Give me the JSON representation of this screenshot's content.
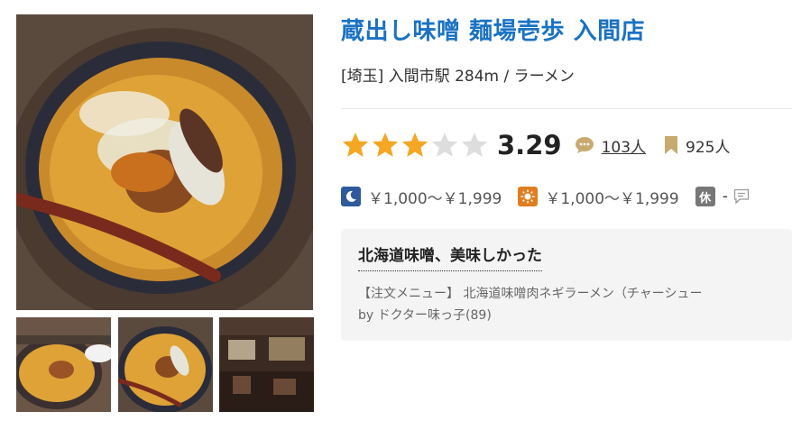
{
  "restaurant": {
    "name": "蔵出し味噌 麺場壱歩 入間店",
    "area": "[埼玉] 入間市駅 284m / ラーメン"
  },
  "rating": {
    "score": "3.29",
    "stars_filled": 3,
    "stars_total": 5,
    "review_count": "103人",
    "bookmark_count": "925人",
    "star_color": "#f5a623",
    "star_empty_color": "#dddddd"
  },
  "price": {
    "dinner": "￥1,000～￥1,999",
    "lunch": "￥1,000～￥1,999",
    "holiday_label": "休",
    "holiday_value": "-"
  },
  "review": {
    "title": "北海道味噌、美味しかった",
    "text": "【注文メニュー】 北海道味噌肉ネギラーメン（チャーシュー",
    "by": "by ドクター味っ子(89)"
  },
  "icons": [
    "ramen-photo",
    "speech-bubble-icon",
    "bookmark-icon",
    "moon-icon",
    "sun-icon",
    "comment-icon"
  ]
}
